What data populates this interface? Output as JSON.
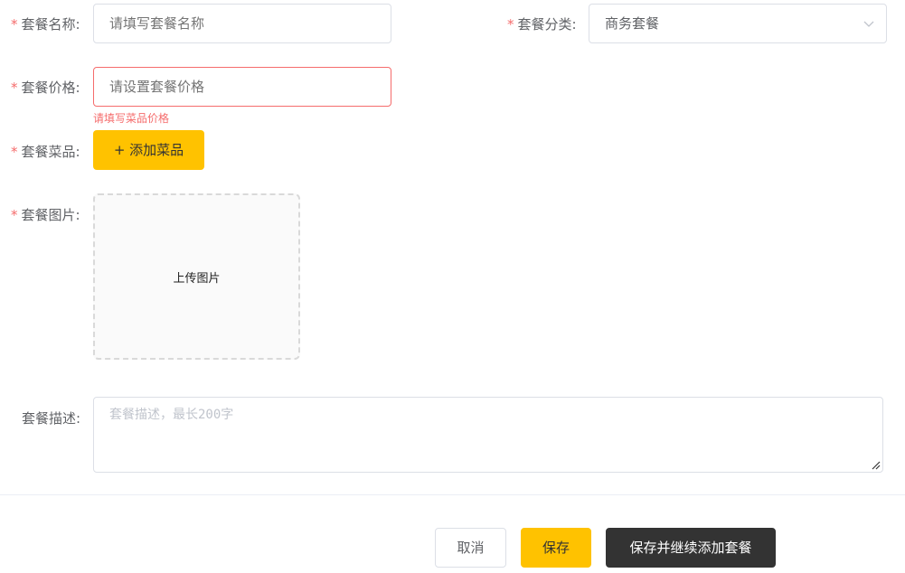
{
  "form": {
    "name": {
      "required_mark": "*",
      "label": "套餐名称:",
      "placeholder": "请填写套餐名称"
    },
    "category": {
      "required_mark": "*",
      "label": "套餐分类:",
      "value": "商务套餐",
      "icon": "chevron-down-icon"
    },
    "price": {
      "required_mark": "*",
      "label": "套餐价格:",
      "placeholder": "请设置套餐价格",
      "error": "请填写菜品价格"
    },
    "dishes": {
      "required_mark": "*",
      "label": "套餐菜品:",
      "add_button": "+ 添加菜品"
    },
    "image": {
      "required_mark": "*",
      "label": "套餐图片:",
      "upload_text": "上传图片"
    },
    "description": {
      "label": "套餐描述:",
      "placeholder": "套餐描述，最长200字"
    }
  },
  "footer": {
    "cancel": "取消",
    "save": "保存",
    "save_continue": "保存并继续添加套餐"
  },
  "colors": {
    "accent": "#ffc200",
    "error": "#f56c6c",
    "dark": "#333333"
  }
}
